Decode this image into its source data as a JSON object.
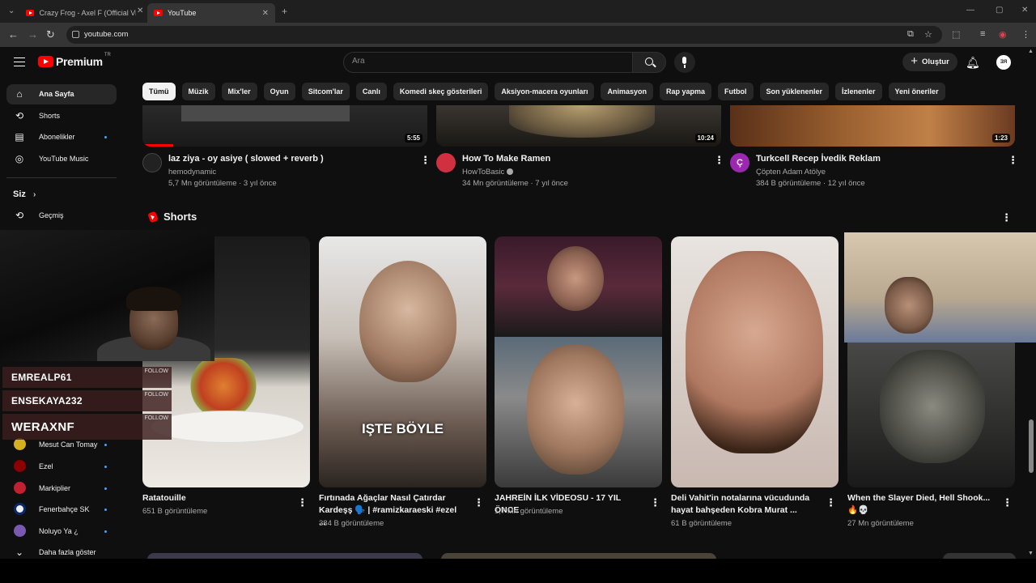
{
  "browser": {
    "tabs": [
      {
        "title": "Crazy Frog - Axel F (Official Vid",
        "active": false
      },
      {
        "title": "YouTube",
        "active": true
      }
    ],
    "url": "youtube.com"
  },
  "masthead": {
    "logo_text": "Premium",
    "country_code": "TR",
    "search_placeholder": "Ara",
    "create_label": "Oluştur"
  },
  "chips": [
    "Tümü",
    "Müzik",
    "Mix'ler",
    "Oyun",
    "Sitcom'lar",
    "Canlı",
    "Komedi skeç gösterileri",
    "Aksiyon-macera oyunları",
    "Animasyon",
    "Rap yapma",
    "Futbol",
    "Son yüklenenler",
    "İzlenenler",
    "Yeni öneriler"
  ],
  "sidebar": {
    "items": [
      {
        "label": "Ana Sayfa",
        "icon": "home-icon"
      },
      {
        "label": "Shorts",
        "icon": "shorts-icon"
      },
      {
        "label": "Abonelikler",
        "icon": "subscriptions-icon"
      },
      {
        "label": "YouTube Music",
        "icon": "youtube-music-icon"
      }
    ],
    "you_heading": "Siz",
    "history_label": "Geçmiş",
    "subscriptions": [
      {
        "label": "Mesut Can Tomay",
        "color": "#d4b020"
      },
      {
        "label": "Ezel",
        "color": "#8b0000"
      },
      {
        "label": "Markiplier",
        "color": "#c02030"
      },
      {
        "label": "Fenerbahçe SK",
        "color": "#f0f0f0"
      },
      {
        "label": "Noluyo Ya ¿",
        "color": "#7a5ab0"
      }
    ],
    "show_more_label": "Daha fazla göster"
  },
  "videos": [
    {
      "title": "laz ziya - oy asiye ( slowed + reverb )",
      "channel": "hemodynamic",
      "meta": "5,7 Mn görüntüleme · 3 yıl önce",
      "duration": "5:55",
      "avatar_color": "#222222",
      "avatar_text": ""
    },
    {
      "title": "How To Make Ramen",
      "channel": "HowToBasic",
      "meta": "34 Mn görüntüleme · 7 yıl önce",
      "duration": "10:24",
      "avatar_color": "#d03040",
      "avatar_text": ""
    },
    {
      "title": "Turkcell Recep İvedik Reklam",
      "channel": "Çöpten Adam Atölye",
      "meta": "384 B görüntüleme · 12 yıl önce",
      "duration": "1:23",
      "avatar_color": "#9c27b0",
      "avatar_text": "Ç"
    }
  ],
  "shorts": {
    "heading": "Shorts",
    "items": [
      {
        "title": "Ratatouille",
        "views": "651 B görüntüleme"
      },
      {
        "title": "Fırtınada Ağaçlar Nasıl Çatırdar Kardeşş 🗣️ | #ramizkaraeski #ezel ...",
        "views": "384 B görüntüleme",
        "overlay_text": "IŞTE BÖYLE"
      },
      {
        "title": "JAHREİN İLK VİDEOSU - 17 YIL ÖNCE",
        "views": "1,7 Mn görüntüleme"
      },
      {
        "title": "Deli Vahit'in notalarına vücudunda hayat bahşeden Kobra Murat ...",
        "views": "61 B görüntüleme"
      },
      {
        "title": "When the Slayer Died, Hell Shook...🔥💀",
        "views": "27 Mn görüntüleme"
      }
    ]
  },
  "stream_overlay": {
    "followers": [
      {
        "name": "EMREALP61",
        "button": "FOLLOW"
      },
      {
        "name": "ENSEKAYA232",
        "button": "FOLLOW"
      },
      {
        "name": "WERAXNF",
        "button": "FOLLOW"
      }
    ]
  },
  "colors": {
    "accent": "#ff0000",
    "background": "#0f0f0f",
    "chip": "#272727"
  }
}
